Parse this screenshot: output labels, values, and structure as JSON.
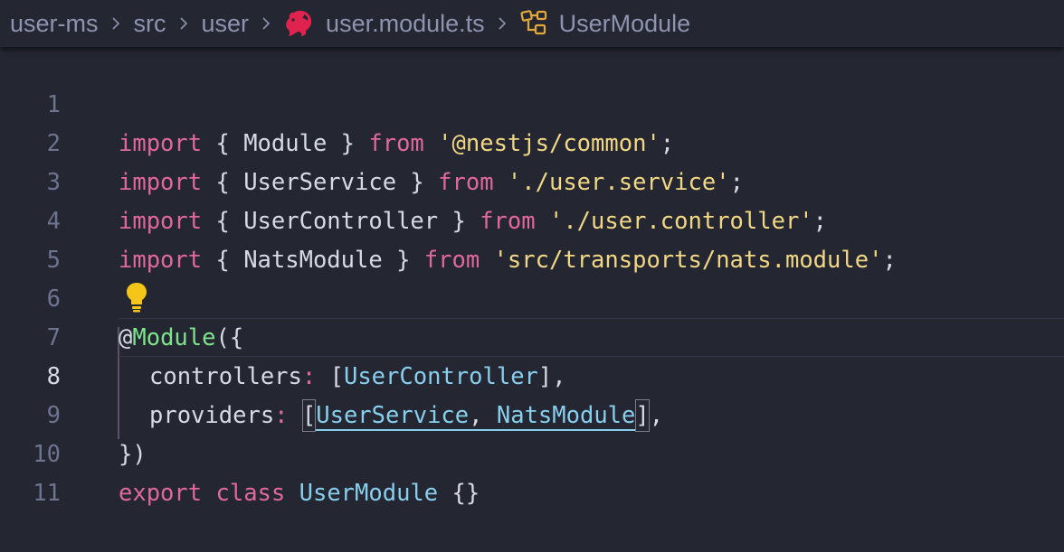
{
  "breadcrumb": {
    "items": [
      "user-ms",
      "src",
      "user",
      "user.module.ts",
      "UserModule"
    ]
  },
  "icons": {
    "file": "nestjs-file-icon",
    "symbol": "module-symbol-icon",
    "separator": "chevron-right-icon",
    "hint": "lightbulb-icon"
  },
  "colors": {
    "background": "#242632",
    "keyword": "#e0689e",
    "string": "#f2d884",
    "decorator": "#7ee38c",
    "class": "#88cfee",
    "nest_brand": "#e0234e"
  },
  "editor": {
    "active_line": "8",
    "line_numbers": [
      "1",
      "2",
      "3",
      "4",
      "5",
      "6",
      "7",
      "8",
      "9",
      "10",
      "11"
    ],
    "lines": [
      {
        "kw1": "import",
        "p1": " { ",
        "id": "Module",
        "p2": " } ",
        "kw2": "from",
        "sp": " ",
        "str": "'@nestjs/common'",
        "end": ";"
      },
      {
        "kw1": "import",
        "p1": " { ",
        "id": "UserService",
        "p2": " } ",
        "kw2": "from",
        "sp": " ",
        "str": "'./user.service'",
        "end": ";"
      },
      {
        "kw1": "import",
        "p1": " { ",
        "id": "UserController",
        "p2": " } ",
        "kw2": "from",
        "sp": " ",
        "str": "'./user.controller'",
        "end": ";"
      },
      {
        "kw1": "import",
        "p1": " { ",
        "id": "NatsModule",
        "p2": " } ",
        "kw2": "from",
        "sp": " ",
        "str": "'src/transports/nats.module'",
        "end": ";"
      }
    ],
    "decorator_at": "@",
    "decorator_name": "Module",
    "decorator_open": "({",
    "controllers_key": "controllers",
    "colon": ":",
    "controllers_open": " [",
    "controllers_value": "UserController",
    "controllers_close": "],",
    "providers_key": "providers",
    "providers_open": "[",
    "providers_value_1": "UserService",
    "providers_comma": ", ",
    "providers_value_2": "NatsModule",
    "providers_close": "]",
    "providers_end": ",",
    "decorator_close": "})",
    "export_kw": "export",
    "class_kw": "class",
    "class_name": "UserModule",
    "class_body": "{}"
  }
}
